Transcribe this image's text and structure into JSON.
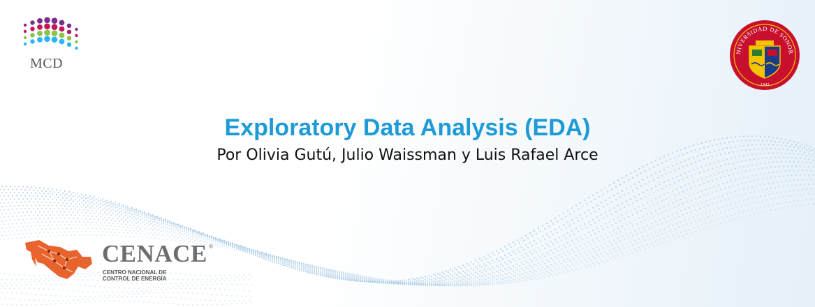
{
  "logos": {
    "mcd": {
      "text": "MCD",
      "icon": "mcd-dots-logo",
      "colors": [
        "#7b2d8e",
        "#c2185b",
        "#8bc34a",
        "#29b6f6"
      ]
    },
    "university_seal": {
      "text": "UNIVERSIDAD DE SONORA",
      "year": "1942",
      "icon": "unison-seal",
      "colors": [
        "#c8102e",
        "#f2c500",
        "#1b3a8a"
      ]
    },
    "cenace": {
      "name": "CENACE",
      "registered_mark": "®",
      "subtitle_line1": "CENTRO NACIONAL DE",
      "subtitle_line2": "CONTROL DE ENERGÍA",
      "icon": "mexico-map-network-icon",
      "colors": [
        "#e8642c",
        "#6d6e71"
      ]
    }
  },
  "slide": {
    "title": "Exploratory Data Analysis (EDA)",
    "subtitle": "Por Olivia Gutú, Julio Waissman y Luis Rafael Arce"
  },
  "theme": {
    "title_color": "#1e9bd7",
    "dot_wave_color": "#a9cbe6"
  }
}
